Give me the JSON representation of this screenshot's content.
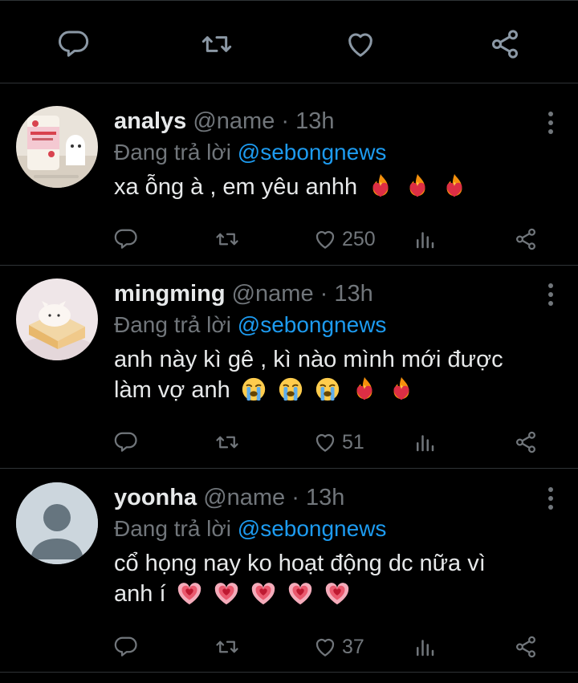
{
  "colors": {
    "background": "#000000",
    "divider": "#2f3336",
    "muted": "#71767b",
    "mention": "#1d9bf0",
    "text": "#e7e9ea"
  },
  "top_actions": [
    {
      "icon": "comment-icon"
    },
    {
      "icon": "retweet-icon"
    },
    {
      "icon": "heart-icon"
    },
    {
      "icon": "share-icon"
    }
  ],
  "tweets": [
    {
      "name": "analys",
      "handle": "@name",
      "separator": "·",
      "time": "13h",
      "reply_prefix": "Đang trả lời",
      "reply_to": "@sebongnews",
      "text": "xa ỗng à , em yêu anhh",
      "emojis": [
        "heart-on-fire",
        "heart-on-fire",
        "heart-on-fire"
      ],
      "likes": "250",
      "avatar": "strawberry-milk"
    },
    {
      "name": "mingming",
      "handle": "@name",
      "separator": "·",
      "time": "13h",
      "reply_prefix": "Đang trả lời",
      "reply_to": "@sebongnews",
      "text_line1": "anh này kì gê , kì nào mình mới được",
      "text_line2": "làm vợ anh",
      "emojis": [
        "loudly-crying",
        "loudly-crying",
        "loudly-crying",
        "heart-on-fire",
        "heart-on-fire"
      ],
      "likes": "51",
      "avatar": "cake"
    },
    {
      "name": "yoonha",
      "handle": "@name",
      "separator": "·",
      "time": "13h",
      "reply_prefix": "Đang trả lời",
      "reply_to": "@sebongnews",
      "text_line1": "cổ họng nay ko hoạt động dc nữa vì",
      "text_line2": "anh í",
      "emojis": [
        "growing-heart",
        "growing-heart",
        "growing-heart",
        "growing-heart",
        "growing-heart"
      ],
      "likes": "37",
      "avatar": "default-profile"
    }
  ]
}
